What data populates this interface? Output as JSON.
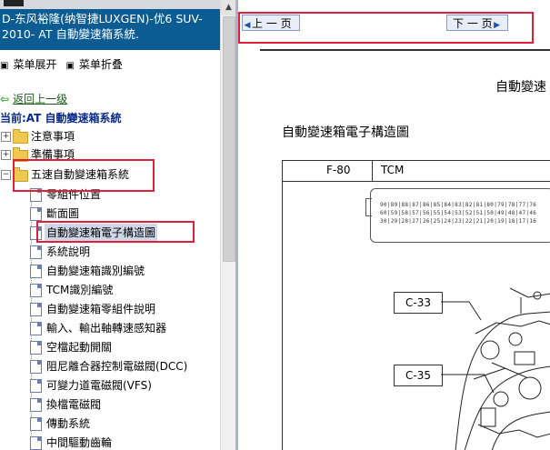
{
  "left": {
    "title_lines": [
      "D-东风裕隆(纳智捷LUXGEN)-优6 SUV-",
      "2010- AT 自動變速箱系統."
    ],
    "menu_expand": "菜单展开",
    "menu_collapse": "菜单折叠",
    "back_link": "返回上一级",
    "current_label": "当前:AT 自動變速箱系統",
    "folders": [
      {
        "label": "注意事項",
        "expander": "+"
      },
      {
        "label": "準備事項",
        "expander": "+"
      },
      {
        "label": "五速自動變速箱系統",
        "expander": "−"
      }
    ],
    "docs": [
      "零組件位置",
      "斷面圖",
      "自動變速箱電子構造圖",
      "系統說明",
      "自動變速箱識別編號",
      "TCM識別編號",
      "自動變速箱零組件說明",
      "輸入、輸出軸轉速感知器",
      "空檔起動開關",
      "阻尼離合器控制電磁閥(DCC)",
      "可變力道電磁閥(VFS)",
      "換檔電磁閥",
      "傳動系統",
      "中間驅動齒輪"
    ]
  },
  "right": {
    "prev_label": "上 一 页",
    "next_label": "下 一 页",
    "doc_title": "自動變速",
    "doc_subtitle": "自動變速箱電子構造圖",
    "table": {
      "code": "F-80",
      "name": "TCM"
    },
    "pin_rows": [
      "90|89|88|87|86|85|84|83|82|81|80|79|78|77|76",
      "60|59|58|57|56|55|54|53|52|51|50|49|48|47|46",
      "30|29|28|27|26|25|24|23|22|21|20|19|18|17|16"
    ],
    "callouts": [
      "C-33",
      "C-35"
    ]
  }
}
